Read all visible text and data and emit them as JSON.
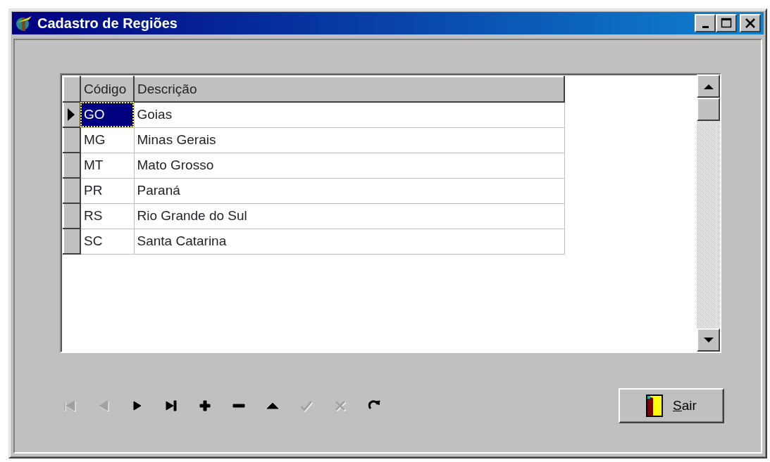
{
  "window": {
    "title": "Cadastro de Regiões"
  },
  "grid": {
    "columns": [
      "Código",
      "Descrição"
    ],
    "rows": [
      {
        "cells": [
          "GO",
          "Goias"
        ],
        "selected": true
      },
      {
        "cells": [
          "MG",
          "Minas Gerais"
        ],
        "selected": false
      },
      {
        "cells": [
          "MT",
          "Mato Grosso"
        ],
        "selected": false
      },
      {
        "cells": [
          "PR",
          "Paraná"
        ],
        "selected": false
      },
      {
        "cells": [
          "RS",
          "Rio Grande do Sul"
        ],
        "selected": false
      },
      {
        "cells": [
          "SC",
          "Santa Catarina"
        ],
        "selected": false
      }
    ]
  },
  "navigator": [
    {
      "kind": "first",
      "disabled": true
    },
    {
      "kind": "prior",
      "disabled": true
    },
    {
      "kind": "next",
      "disabled": false
    },
    {
      "kind": "last",
      "disabled": false
    },
    {
      "kind": "insert",
      "disabled": false
    },
    {
      "kind": "delete",
      "disabled": false
    },
    {
      "kind": "edit",
      "disabled": false
    },
    {
      "kind": "post",
      "disabled": true
    },
    {
      "kind": "cancel",
      "disabled": true
    },
    {
      "kind": "refresh",
      "disabled": false
    }
  ],
  "exit_button": {
    "label": "Sair",
    "mnemonic_underlined": true
  }
}
